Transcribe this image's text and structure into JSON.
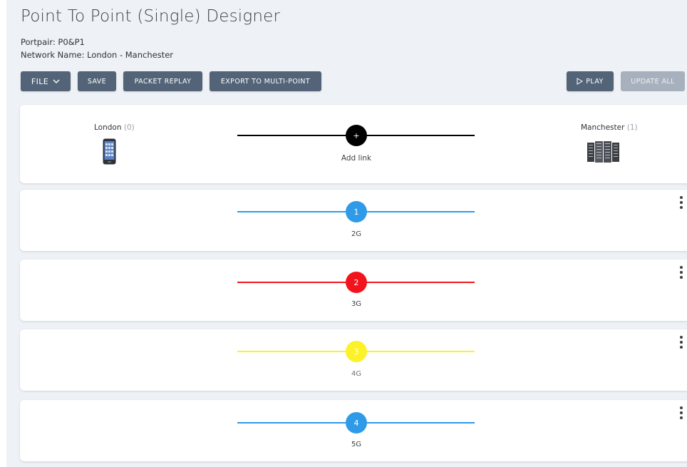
{
  "page": {
    "title": "Point To Point (Single) Designer",
    "portpair": "Portpair: P0&P1",
    "network_name": "Network Name: London - Manchester"
  },
  "toolbar": {
    "file_label": "FILE",
    "save_label": "SAVE",
    "packet_replay_label": "PACKET REPLAY",
    "export_label": "EXPORT TO MULTI-POINT",
    "play_label": "PLAY",
    "update_all_label": "UPDATE ALL"
  },
  "endpoints": {
    "left": {
      "name": "London",
      "count": "(0)",
      "icon": "mobile-phone-icon"
    },
    "right": {
      "name": "Manchester",
      "count": "(1)",
      "icon": "server-rack-icon"
    }
  },
  "add_link": {
    "symbol": "+",
    "label": "Add link",
    "color": "#000000"
  },
  "links": [
    {
      "number": "1",
      "label": "2G",
      "color": "#2f9be8"
    },
    {
      "number": "2",
      "label": "3G",
      "color": "#f2141c"
    },
    {
      "number": "3",
      "label": "4G",
      "color": "#fbf22a"
    },
    {
      "number": "4",
      "label": "5G",
      "color": "#2f9be8"
    }
  ]
}
